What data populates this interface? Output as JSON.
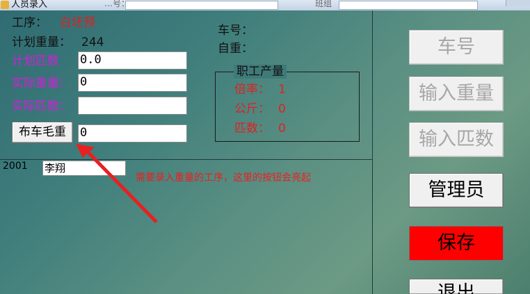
{
  "window": {
    "title": "人员录入",
    "ghost_label_1": "…号：",
    "ghost_label_2": "班组"
  },
  "form": {
    "process_label": "工序：",
    "process_value": "白坯预",
    "planned_weight_label": "计划重量：",
    "planned_weight_value": "244",
    "planned_bolts_label": "计划匹数",
    "planned_bolts_value": "0.0",
    "actual_weight_label": "实际重量：",
    "actual_weight_value": "0",
    "actual_bolts_label": "实际匹数：",
    "actual_bolts_value": "",
    "cart_gross_button": "布车毛重",
    "cart_gross_value": "0",
    "car_no_label": "车号：",
    "self_weight_label": "自重："
  },
  "output_group": {
    "legend": "职工产量",
    "rate_label": "倍率：",
    "rate_value": "1",
    "kg_label": "公斤：",
    "kg_value": "0",
    "bolts_label": "匹数：",
    "bolts_value": "0"
  },
  "employee": {
    "id": "2001",
    "name": "李翔"
  },
  "annotation": {
    "text": "需要录入重量的工序，这里的按钮会亮起"
  },
  "side_buttons": {
    "car_no": "车号",
    "input_weight": "输入重量",
    "input_bolts": "输入匹数",
    "admin": "管理员",
    "save": "保存",
    "exit": "退出"
  },
  "colors": {
    "save_button": "#ff0000",
    "magenta_label": "#d21fd8",
    "red_text": "#e02020"
  }
}
